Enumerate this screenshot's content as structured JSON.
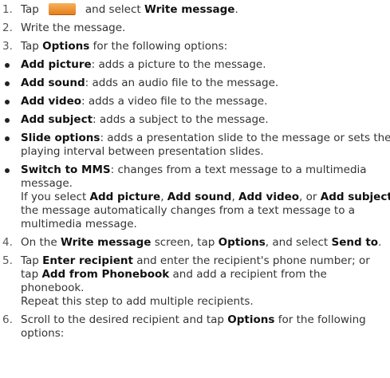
{
  "steps": [
    {
      "num": "1.",
      "pre": "Tap",
      "icon": "messaging-icon",
      "mid": "and select",
      "bold": "Write message",
      "post": "."
    },
    {
      "num": "2.",
      "text": "Write the message."
    },
    {
      "num": "3.",
      "pre": "Tap",
      "bold": "Options",
      "post": "for the following options:"
    }
  ],
  "bullets": [
    {
      "bold": "Add picture",
      "text": ": adds a picture to the message."
    },
    {
      "bold": "Add sound",
      "text": ": adds an audio file to the message."
    },
    {
      "bold": "Add video",
      "text": ": adds a video file to the message."
    },
    {
      "bold": "Add subject",
      "text": ": adds a subject to the message."
    },
    {
      "bold": "Slide options",
      "text": ": adds a presentation slide to the message or sets the",
      "line2": "playing interval between presentation slides."
    },
    {
      "bold": "Switch to MMS",
      "text": ": changes from a text message to a multimedia",
      "line2": "message."
    }
  ],
  "mms_note": {
    "pre": "If you select",
    "b1": "Add picture",
    "sep1": ",",
    "b2": "Add sound",
    "sep2": ",",
    "b3": "Add video",
    "sep3": ", or",
    "b4": "Add subject",
    "post": ",",
    "line2": "the message automatically changes from a text message to a",
    "line3": "multimedia message."
  },
  "step4": {
    "num": "4.",
    "pre": "On the",
    "b1": "Write message",
    "mid": "screen, tap",
    "b2": "Options",
    "mid2": ", and select",
    "b3": "Send to",
    "post": "."
  },
  "step5": {
    "num": "5.",
    "pre": "Tap",
    "b1": "Enter recipient",
    "mid": "and enter the recipient's phone number; or",
    "l2pre": "tap",
    "b2": "Add from Phonebook",
    "l2post": "and add a recipient from the",
    "line3": "phonebook.",
    "line4": "Repeat this step to add multiple recipients."
  },
  "step6": {
    "num": "6.",
    "pre": "Scroll to the desired recipient and tap",
    "b1": "Options",
    "post": "for the following",
    "line2": "options:"
  }
}
